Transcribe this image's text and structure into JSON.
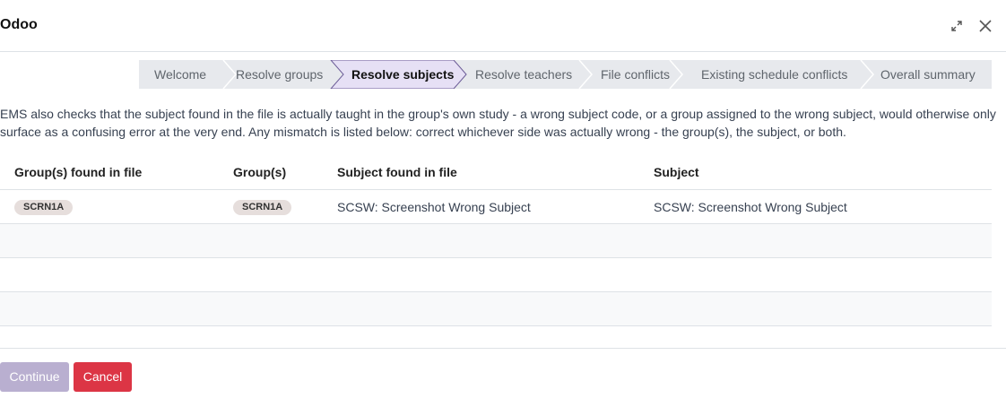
{
  "dialog": {
    "title": "Odoo"
  },
  "steps": [
    {
      "label": "Welcome",
      "active": false
    },
    {
      "label": "Resolve groups",
      "active": false
    },
    {
      "label": "Resolve subjects",
      "active": true
    },
    {
      "label": "Resolve teachers",
      "active": false
    },
    {
      "label": "File conflicts",
      "active": false
    },
    {
      "label": "Existing schedule conflicts",
      "active": false
    },
    {
      "label": "Overall summary",
      "active": false
    }
  ],
  "description": "EMS also checks that the subject found in the file is actually taught in the group's own study - a wrong subject code, or a group assigned to the wrong subject, would otherwise only surface as a confusing error at the very end. Any mismatch is listed below: correct whichever side was actually wrong - the group(s), the subject, or both.",
  "table": {
    "columns": [
      "Group(s) found in file",
      "Group(s)",
      "Subject found in file",
      "Subject"
    ],
    "rows": [
      {
        "groups_in_file": "SCRN1A",
        "groups": "SCRN1A",
        "subject_in_file": "SCSW: Screenshot Wrong Subject",
        "subject": "SCSW: Screenshot Wrong Subject"
      }
    ]
  },
  "footer": {
    "continue_label": "Continue",
    "cancel_label": "Cancel"
  },
  "colors": {
    "primary_disabled": "#b9afd0",
    "danger": "#dc3545",
    "steps_bg": "#e7e9ed",
    "badge_bg": "#e6dedc"
  }
}
